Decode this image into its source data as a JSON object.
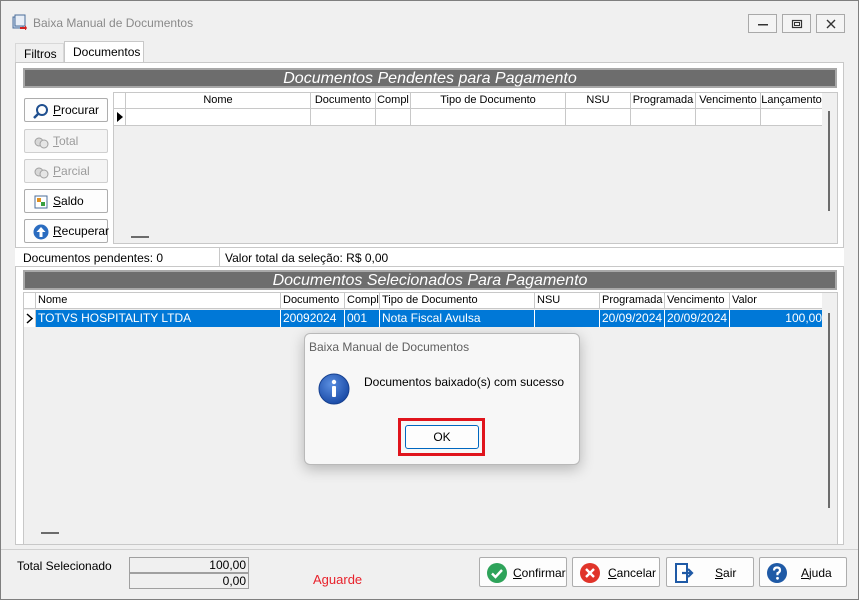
{
  "window": {
    "title": "Baixa Manual de Documentos"
  },
  "tabs": [
    {
      "label": "Filtros",
      "active": false
    },
    {
      "label": "Documentos",
      "active": true
    }
  ],
  "pending": {
    "header": "Documentos Pendentes para Pagamento",
    "columns": [
      "Nome",
      "Documento",
      "Compl",
      "Tipo de Documento",
      "NSU",
      "Programada",
      "Vencimento",
      "Lançamento"
    ],
    "buttons": {
      "procurar": {
        "label": "Procurar",
        "ul": "P",
        "rest": "rocurar"
      },
      "total": {
        "label": "Total",
        "ul": "T",
        "rest": "otal"
      },
      "parcial": {
        "label": "Parcial",
        "ul": "P",
        "rest": "arcial"
      },
      "saldo": {
        "label": "Saldo",
        "ul": "S",
        "rest": "aldo"
      },
      "recuperar": {
        "label": "Recuperar",
        "ul": "R",
        "rest": "ecuperar"
      }
    },
    "status": {
      "count": "Documentos pendentes: 0",
      "total": "Valor total da seleção: R$ 0,00"
    }
  },
  "selected": {
    "header": "Documentos Selecionados Para Pagamento",
    "columns": [
      "Nome",
      "Documento",
      "Compl",
      "Tipo de Documento",
      "NSU",
      "Programada",
      "Vencimento",
      "Valor"
    ],
    "rows": [
      {
        "nome": "TOTVS HOSPITALITY LTDA",
        "documento": "20092024",
        "compl": "001",
        "tipo": "Nota Fiscal Avulsa",
        "nsu": "",
        "programada": "20/09/2024",
        "vencimento": "20/09/2024",
        "valor": "100,00"
      }
    ]
  },
  "footer": {
    "total_label": "Total Selecionado",
    "total_value": "100,00",
    "second_value": "0,00",
    "waiting": "Aguarde",
    "buttons": {
      "confirmar": {
        "ul": "C",
        "rest": "onfirmar"
      },
      "cancelar": {
        "ul": "C",
        "rest": "ancelar"
      },
      "sair": {
        "ul": "S",
        "rest": "air"
      },
      "ajuda": {
        "ul": "A",
        "rest": "juda"
      }
    }
  },
  "dialog": {
    "title": "Baixa Manual de Documentos",
    "message": "Documentos baixado(s) com sucesso",
    "ok_label": "OK"
  },
  "colors": {
    "selection": "#0078d7",
    "header_bar": "#6d6d6d",
    "highlight": "#e0141c",
    "waiting_text": "#e8222c"
  }
}
